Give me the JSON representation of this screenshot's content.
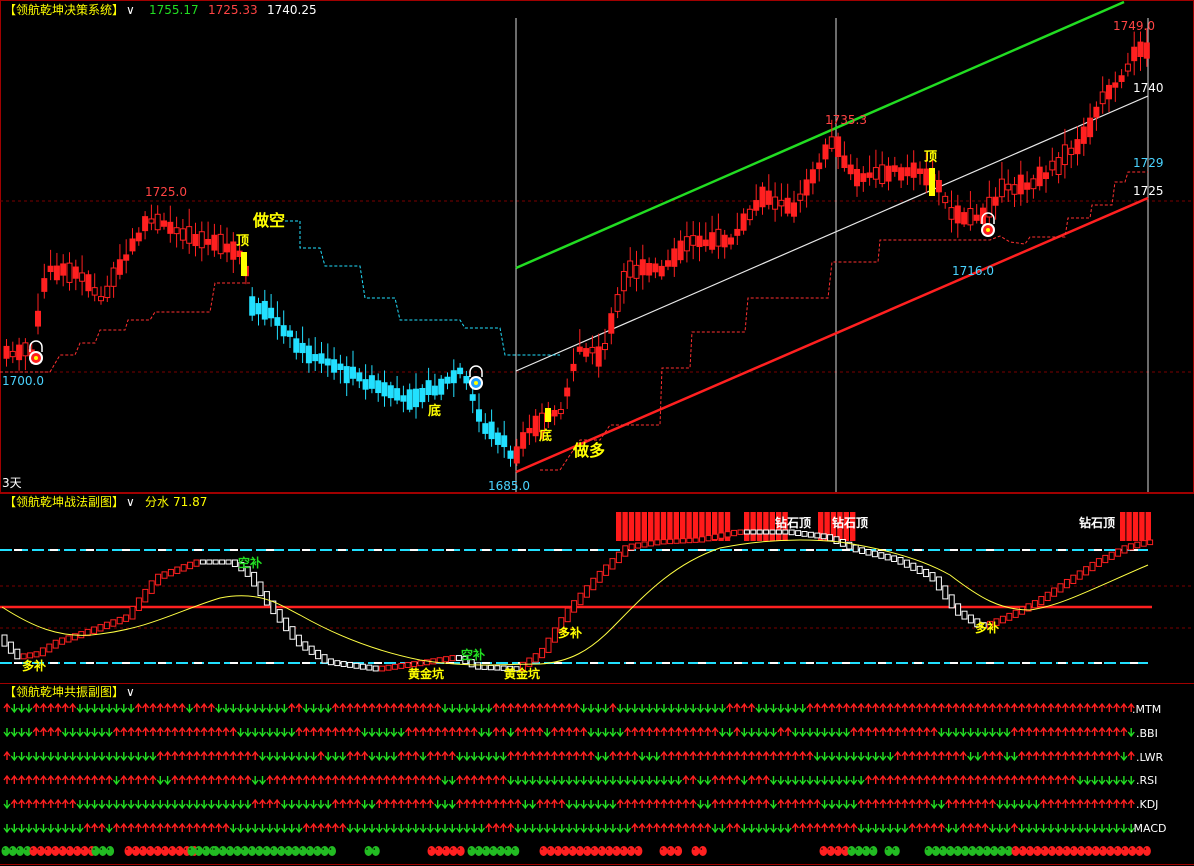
{
  "main": {
    "title": "【领航乾坤决策系统】",
    "dropdown": "∨",
    "val_green": "1755.17",
    "val_red": "1725.33",
    "val_white": "1740.25",
    "period_label": "3天",
    "price_labels": [
      {
        "text": "1700.0",
        "color": "#4ad3ff"
      },
      {
        "text": "1725.0",
        "color": "#ff4444"
      },
      {
        "text": "1685.0",
        "color": "#4ad3ff"
      },
      {
        "text": "1735.3",
        "color": "#ff4444"
      },
      {
        "text": "1716.0",
        "color": "#4ad3ff"
      },
      {
        "text": "1749.0",
        "color": "#ff4444"
      },
      {
        "text": "1740",
        "color": "#ffffff"
      },
      {
        "text": "1729",
        "color": "#4ad3ff"
      },
      {
        "text": "1725",
        "color": "#ffffff"
      }
    ],
    "annotations": {
      "short": "做空",
      "long": "做多",
      "top1": "顶",
      "top2": "顶",
      "bottom1": "底",
      "bottom2": "底"
    },
    "colors": {
      "up": "#ff2020",
      "down": "#22e0ff",
      "channel_top": "#22dd22",
      "channel_bottom": "#ff2020",
      "mid": "#e8e8e8",
      "signal": "#ffff00"
    }
  },
  "sub1": {
    "title": "【领航乾坤战法副图】",
    "dropdown": "∨",
    "value_label": "分水",
    "value": "71.87",
    "labels": {
      "diamond_top_1": "钻石顶",
      "diamond_top_2": "钻石顶",
      "diamond_top_3": "钻石顶",
      "empty_add_1": "空补",
      "empty_add_2": "空补",
      "long_add_1": "多补",
      "long_add_2": "多补",
      "long_add_3": "多补",
      "gold_pit_1": "黄金坑",
      "gold_pit_2": "黄金坑"
    }
  },
  "sub2": {
    "title": "【领航乾坤共振副图】",
    "dropdown": "∨",
    "rows": [
      ".MTM",
      ".BBI",
      ".LWR",
      ".RSI",
      ".KDJ",
      ".MACD"
    ]
  }
}
